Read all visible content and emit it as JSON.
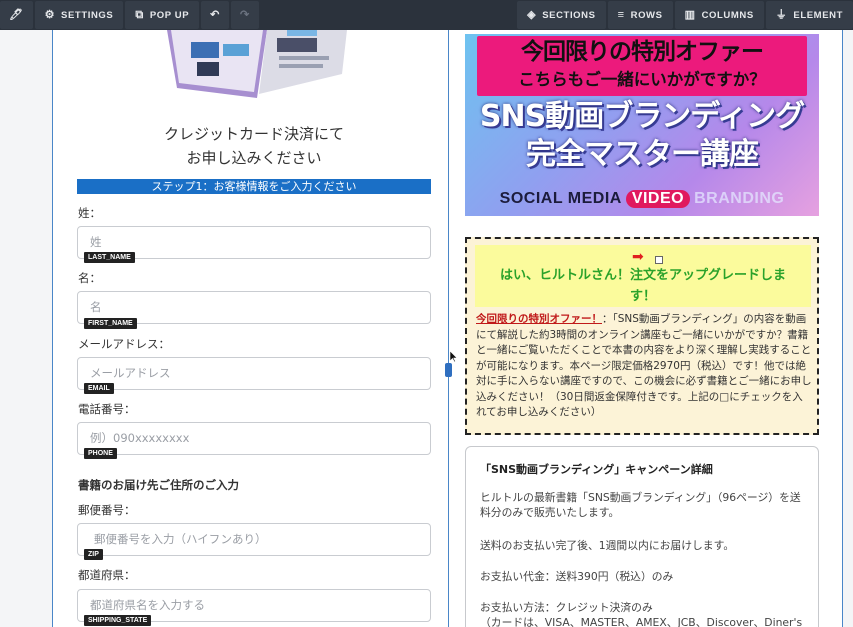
{
  "toolbar": {
    "pin_icon": "pin-icon",
    "settings_label": "SETTINGS",
    "popup_label": "POP UP",
    "undo_icon": "undo-icon",
    "redo_icon": "redo-icon",
    "sections_label": "SECTIONS",
    "rows_label": "ROWS",
    "columns_label": "COLUMNS",
    "elements_label": "ELEMENT"
  },
  "form": {
    "heading_line1": "クレジットカード決済にて",
    "heading_line2": "お申し込みください",
    "step_label": "ステップ1：お客様情報をご入力ください",
    "last_name": {
      "label": "姓：",
      "placeholder": "姓",
      "tag": "LAST_NAME"
    },
    "first_name": {
      "label": "名：",
      "placeholder": "名",
      "tag": "FIRST_NAME"
    },
    "email": {
      "label": "メールアドレス：",
      "placeholder": "メールアドレス",
      "tag": "EMAIL"
    },
    "phone": {
      "label": "電話番号：",
      "placeholder": "例）090xxxxxxxx",
      "tag": "PHONE"
    },
    "address_heading": "書籍のお届け先ご住所のご入力",
    "zip": {
      "label": "郵便番号：",
      "placeholder": "郵便番号を入力（ハイフンあり）",
      "tag": "ZIP"
    },
    "state": {
      "label": "都道府県：",
      "placeholder": "都道府県名を入力する",
      "tag": "SHIPPING_STATE"
    }
  },
  "banner": {
    "line1": "今回限りの特別オファー",
    "line2": "こちらもご一緒にいかがですか？",
    "title1": "SNS動画ブランディング",
    "title2": "完全マスター講座",
    "social": "SOCIAL MEDIA",
    "video": "VIDEO",
    "branding": "BRANDING"
  },
  "offer": {
    "title_line1": "はい、ヒルトルさん！注文をアップグレードしま",
    "title_line2": "す！",
    "highlight": "今回限りの特別オファー！",
    "body": "：「SNS動画ブランディング」の内容を動画にて解説した約3時間のオンライン講座もご一緒にいかがですか？書籍と一緒にご覧いただくことで本書の内容をより深く理解し実践することが可能になります。本ページ限定価格2970円（税込）です！他では絶対に手に入らない講座ですので、この機会に必ず書籍とご一緒にお申し込みください！（30日間返金保障付きです。上記の□にチェックを入れてお申し込みください）"
  },
  "details": {
    "title": "「SNS動画ブランディング」キャンペーン詳細",
    "p1_line1": "ヒルトルの最新書籍「SNS動画ブランディング」（96ページ）を送",
    "p1_line2": "料分のみで販売いたします。",
    "p2": "送料のお支払い完了後、1週間以内にお届けします。",
    "p3": "お支払い代金：送料390円（税込）のみ",
    "p4": "お支払い方法：クレジット決済のみ",
    "p5": "（カードは、VISA、MASTER、AMEX、JCB、Discover、Diner'sカー"
  }
}
